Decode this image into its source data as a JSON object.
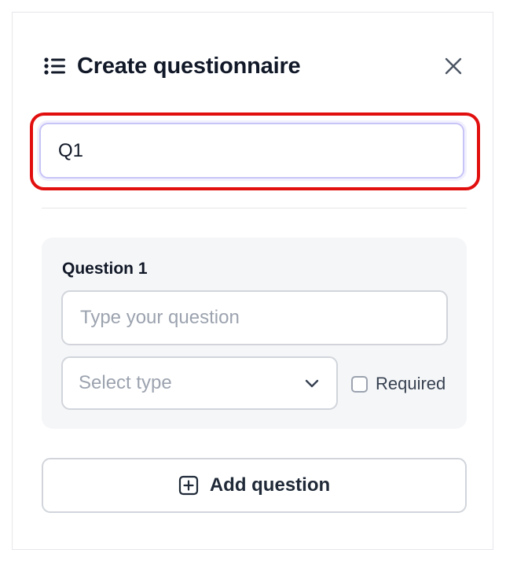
{
  "header": {
    "title": "Create questionnaire",
    "icon": "list-icon",
    "close_icon": "close-icon"
  },
  "questionnaire_name": {
    "value": "Q1"
  },
  "question": {
    "label": "Question 1",
    "text_placeholder": "Type your question",
    "type_placeholder": "Select type",
    "required_label": "Required",
    "required_checked": false
  },
  "actions": {
    "add_label": "Add question",
    "add_icon": "plus-square-icon"
  },
  "colors": {
    "highlight": "#e20f0f",
    "focus_border": "#c7c4f7",
    "card_bg": "#f5f6f8",
    "text": "#111827",
    "placeholder": "#9ca3af"
  }
}
